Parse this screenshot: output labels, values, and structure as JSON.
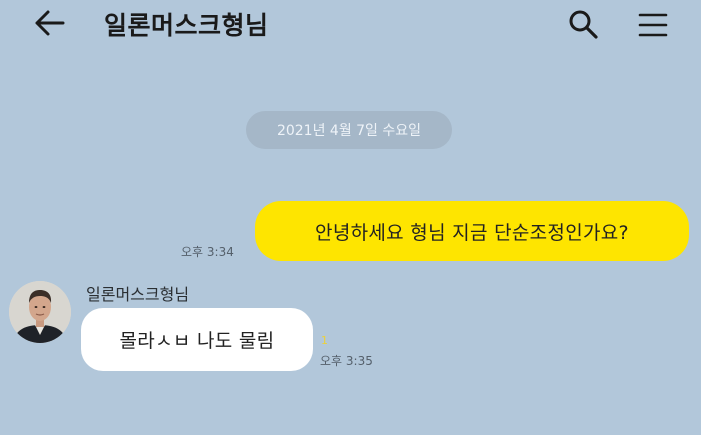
{
  "header": {
    "title": "일론머스크형님"
  },
  "date_divider": "2021년 4월 7일 수요일",
  "messages": [
    {
      "direction": "outgoing",
      "text": "안녕하세요 형님 지금 단순조정인가요?",
      "time": "오후 3:34"
    },
    {
      "direction": "incoming",
      "sender": "일론머스크형님",
      "text": "몰라ㅅㅂ 나도 물림",
      "unread": "1",
      "time": "오후 3:35"
    }
  ],
  "colors": {
    "background": "#b2c7da",
    "outgoing_bubble": "#fee500",
    "incoming_bubble": "#ffffff",
    "date_pill": "#a5b7c8"
  },
  "icons": {
    "back": "arrow-left-icon",
    "search": "search-icon",
    "menu": "hamburger-menu-icon"
  }
}
